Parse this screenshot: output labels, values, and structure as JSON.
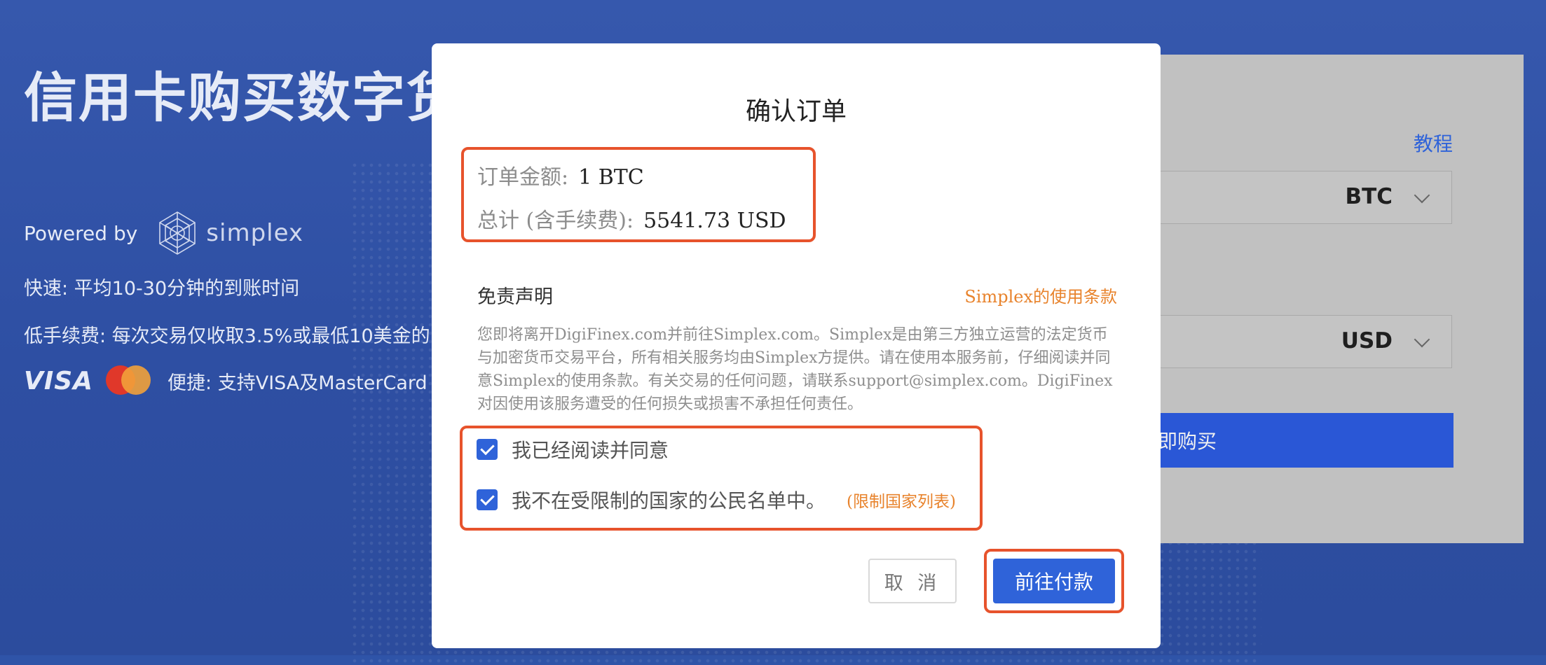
{
  "hero": {
    "title": "信用卡购买数字货",
    "powered_by": "Powered by",
    "brand": "simplex",
    "feature_speed": "快速: 平均10-30分钟的到账时间",
    "feature_fee": "低手续费: 每次交易仅收取3.5%或最低10美金的",
    "cards_visa": "VISA",
    "cards_text": "便捷: 支持VISA及MasterCard"
  },
  "panel": {
    "tutorial_link": "教程",
    "crypto_select": "BTC",
    "fiat_select": "USD",
    "buy_button": "立即购买"
  },
  "modal": {
    "title": "确认订单",
    "order_amount_label": "订单金额:",
    "order_amount_value": "1 BTC",
    "total_label": "总计 (含手续费):",
    "total_value": "5541.73 USD",
    "disclaimer_title": "免责声明",
    "terms_link": "Simplex的使用条款",
    "disclaimer_text": "您即将离开DigiFinex.com并前往Simplex.com。Simplex是由第三方独立运营的法定货币与加密货币交易平台，所有相关服务均由Simplex方提供。请在使用本服务前，仔细阅读并同意Simplex的使用条款。有关交易的任何问题，请联系support@simplex.com。DigiFinex对因使用该服务遭受的任何损失或损害不承担任何责任。",
    "agree_label": "我已经阅读并同意",
    "not_restricted_label": "我不在受限制的国家的公民名单中。",
    "restricted_list_link": "(限制国家列表)",
    "cancel_button": "取 消",
    "pay_button": "前往付款"
  },
  "colors": {
    "background": "#2f54a8",
    "primary": "#2f63d9",
    "link_orange": "#e8832c",
    "highlight_red": "#e7532c"
  }
}
